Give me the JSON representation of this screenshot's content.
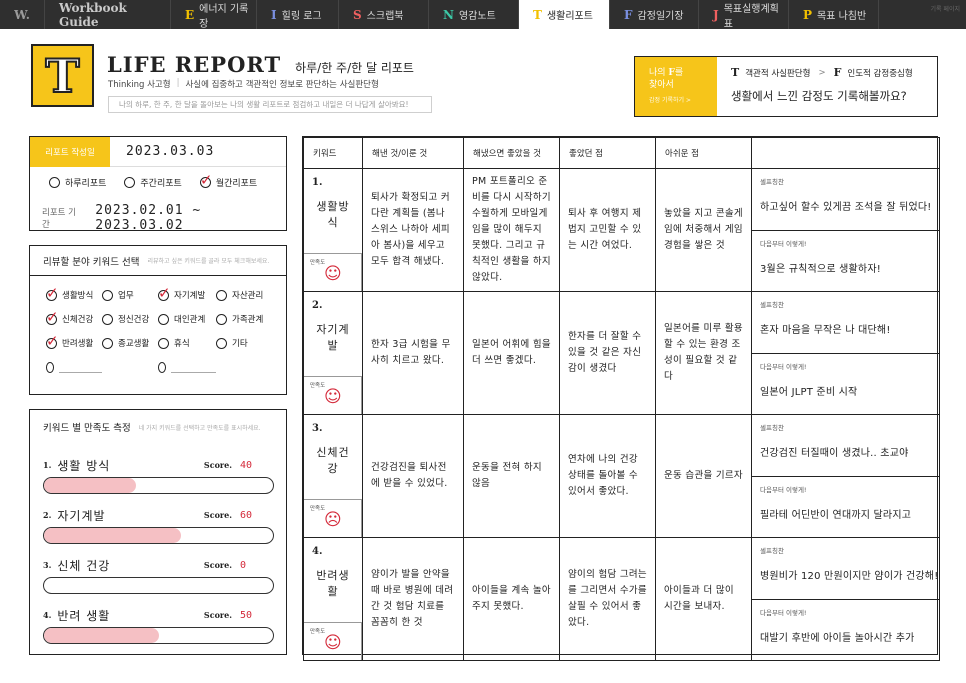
{
  "nav": {
    "logo": "W.",
    "brand": "Workbook Guide",
    "tabs": [
      {
        "letter": "E",
        "label": "에너지 기록장",
        "color": "#f2c100"
      },
      {
        "letter": "I",
        "label": "힐링 로그",
        "color": "#7a8fe0"
      },
      {
        "letter": "S",
        "label": "스크랩북",
        "color": "#f06060"
      },
      {
        "letter": "N",
        "label": "영감노트",
        "color": "#3cc8a6"
      },
      {
        "letter": "T",
        "label": "생활리포트",
        "color": "#f2c100"
      },
      {
        "letter": "F",
        "label": "감정일기장",
        "color": "#7a8fe0"
      },
      {
        "letter": "J",
        "label": "목표실행계획표",
        "color": "#f06060"
      },
      {
        "letter": "P",
        "label": "목표 나침반",
        "color": "#f2c100"
      }
    ],
    "active_index": 4,
    "corner": "기록 페이지"
  },
  "header": {
    "logo_letter": "T",
    "title": "LIFE REPORT",
    "subtitle": "하루/한 주/한 달 리포트",
    "type_label": "Thinking 사고형",
    "type_desc": "사실에 집중하고 객관적인 정보로 판단하는 사실판단형",
    "quote": "나의 하루, 한 주, 한 달을 돌아보는 나의 생활 리포트로 점검하고 내일은 더 나답게 살아봐요!"
  },
  "find_box": {
    "line1_pre": "나의 ",
    "line1_letter": "F",
    "line1_post": "를",
    "line2": "찾아서",
    "more": "감정 기록하기  >",
    "from_letter": "T",
    "from_label": "객관적 사실판단형",
    "to_letter": "F",
    "to_label": "인도적 감정중심형",
    "question": "생활에서 느낀 감정도 기록해볼까요?"
  },
  "report_panel": {
    "tag": "리포트 작성일",
    "date": "2023.03.03",
    "options": [
      {
        "label": "하루리포트",
        "checked": false
      },
      {
        "label": "주간리포트",
        "checked": false
      },
      {
        "label": "월간리포트",
        "checked": true
      }
    ],
    "period_label": "리포트 기간",
    "period_value": "2023.02.01 ~ 2023.03.02"
  },
  "keyword_panel": {
    "title": "리뷰할 분야 키워드 선택",
    "hint": "리뷰하고 싶은 키워드를 골라 모두 체크해보세요.",
    "options": [
      {
        "label": "생활방식",
        "checked": true
      },
      {
        "label": "업무",
        "checked": false
      },
      {
        "label": "자기계발",
        "checked": true
      },
      {
        "label": "자산관리",
        "checked": false
      },
      {
        "label": "신체건강",
        "checked": true
      },
      {
        "label": "정신건강",
        "checked": false
      },
      {
        "label": "대인관계",
        "checked": false
      },
      {
        "label": "가족관계",
        "checked": false
      },
      {
        "label": "반려생활",
        "checked": true
      },
      {
        "label": "종교생활",
        "checked": false
      },
      {
        "label": "휴식",
        "checked": false
      },
      {
        "label": "기타",
        "checked": false
      }
    ]
  },
  "score_panel": {
    "title": "키워드 별 만족도 측정",
    "hint": "네 가지 키워드를 선택하고 만족도를 표시하세요.",
    "score_label": "Score.",
    "items": [
      {
        "num": "1.",
        "name": "생활 방식",
        "score": "40",
        "fill": 0.4
      },
      {
        "num": "2.",
        "name": "자기계발",
        "score": "60",
        "fill": 0.6
      },
      {
        "num": "3.",
        "name": "신체 건강",
        "score": "0",
        "fill": 0
      },
      {
        "num": "4.",
        "name": "반려 생활",
        "score": "50",
        "fill": 0.5
      }
    ]
  },
  "table": {
    "headers": [
      "키워드",
      "해낸 것/이룬 것",
      "해냈으면 좋았을 것",
      "좋았던 점",
      "아쉬운 점",
      ""
    ],
    "sat_label": "만족도",
    "side_labels": [
      "셀프칭찬",
      "다음부터 이렇게!"
    ],
    "rows": [
      {
        "num": "1.",
        "keyword": "생활방식",
        "face": "☺",
        "done": "퇴사가 확정되고 커다란 계획들 (봄나 스위스 나하아 세피아 봄사)을 세우고 모두 합격 해냈다.",
        "wish": "PM 포트폴리오 준비를 다시 시작하기 수월하게 모바일게임을 많이 해두지 못했다. 그리고 규칙적인 생활을 하지 않았다.",
        "good": "퇴사 후 여행지 제법지 고민할 수 있는 시간 여었다.",
        "bad": "놓았을 지고 콘솔게임에 처중해서 게임 경험을 쌓은 것",
        "praise": "하고싶어 할수 있게끔 조석을 잘 뒤었다!",
        "next": "3월은 규칙적으로 생활하자!"
      },
      {
        "num": "2.",
        "keyword": "자기계발",
        "face": "☺",
        "done": "한자 3급 시험을 무사히 치르고 왔다.",
        "wish": "일본어 어휘에 힘을 더 쓰면 좋겠다.",
        "good": "한자를 더 잘할 수 있을 것 같은 자신감이 생겼다",
        "bad": "일본어를 미루 활용할 수 있는 환경 조성이 필요할 것 같다",
        "praise": "혼자 마음을 무작은 나 대단해!",
        "next": "일본어 JLPT 준비 시작"
      },
      {
        "num": "3.",
        "keyword": "신체건강",
        "face": "☹",
        "done": "건강검진을 퇴사전에 받을 수 있었다.",
        "wish": "운동을 전혀 하지 않음",
        "good": "연차에 나의 건강 상태를 돌아볼 수 있어서 좋았다.",
        "bad": "운동 습관을 기르자",
        "praise": "건강검진 터질때이 생겼나.. 초교야",
        "next": "필라테 어딘반이 연대까지 달라지고"
      },
      {
        "num": "4.",
        "keyword": "반려생활",
        "face": "☺",
        "done": "얌이가 발을 안약을 때 바로 병원에 데려간 것 험담 치료를 꼼꼼히 한 것",
        "wish": "아이들을 계속 놀아주지 못했다.",
        "good": "얌이의 험담 그려는를 그리면서 수가를 살필 수 있어서 좋았다.",
        "bad": "아이들과 더 많이 시간을 보내자.",
        "praise": "병원비가 120 만원이지만 얌이가 건강해!",
        "next": "대발기 후반에 아이들 놀아시간 추가"
      }
    ]
  },
  "colors": {
    "accent_yellow": "#f6c51a",
    "check_red": "#d42a3a",
    "bar_pink": "#f5c0c4",
    "nav_dark": "#2f2f2f"
  }
}
